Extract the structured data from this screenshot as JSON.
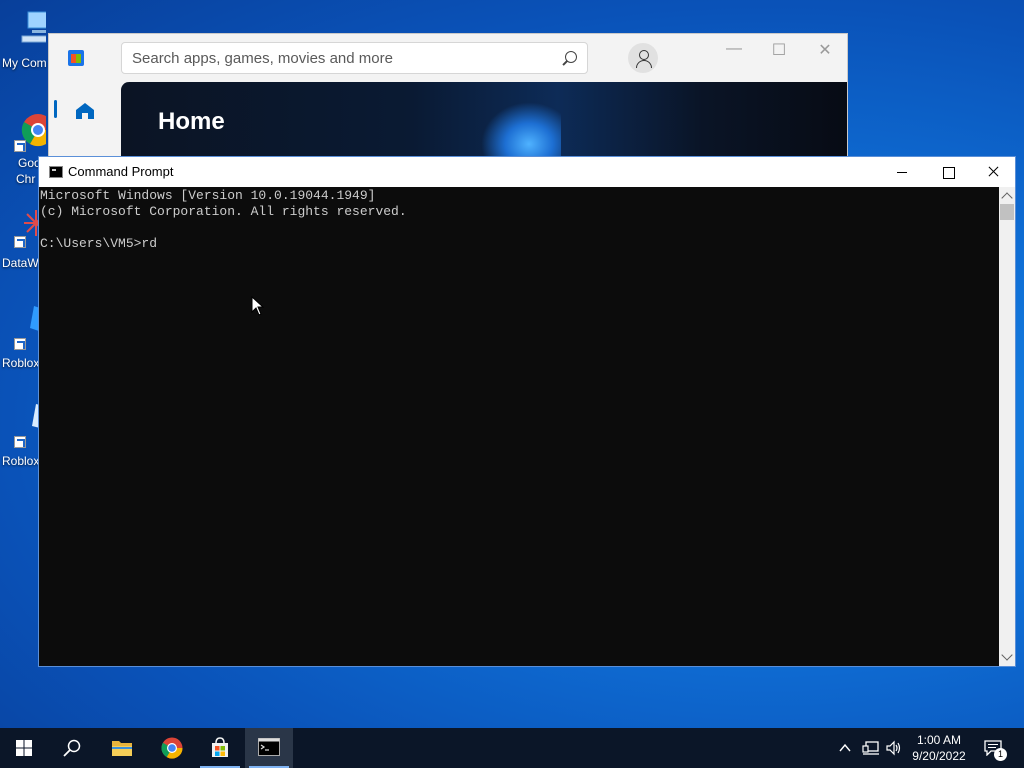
{
  "desktop": {
    "icons": [
      {
        "label": "My Com",
        "icon": "computer-icon"
      },
      {
        "label": "Goo",
        "label2": "Chr",
        "icon": "chrome-icon"
      },
      {
        "label": "DataW",
        "icon": "datawrapper-icon"
      },
      {
        "label": "Roblox",
        "icon": "roblox-icon"
      },
      {
        "label": "Roblox",
        "icon": "roblox-studio-icon"
      }
    ]
  },
  "store": {
    "search_placeholder": "Search apps, games, movies and more",
    "hero_title": "Home",
    "controls": {
      "minimize": "—",
      "maximize": "☐",
      "close": "✕"
    }
  },
  "cmd": {
    "title": "Command Prompt",
    "lines": [
      "Microsoft Windows [Version 10.0.19044.1949]",
      "(c) Microsoft Corporation. All rights reserved.",
      "",
      "C:\\Users\\VM5>rd"
    ]
  },
  "taskbar": {
    "items": [
      "start-icon",
      "search-icon",
      "file-explorer-icon",
      "chrome-icon",
      "microsoft-store-icon",
      "command-prompt-icon"
    ],
    "clock_time": "1:00 AM",
    "clock_date": "9/20/2022",
    "notification_count": "1"
  },
  "colors": {
    "desktop_blue": "#0f6fd6",
    "taskbar": "#0b1628",
    "console_bg": "#0c0c0c",
    "console_text": "#cccccc"
  }
}
